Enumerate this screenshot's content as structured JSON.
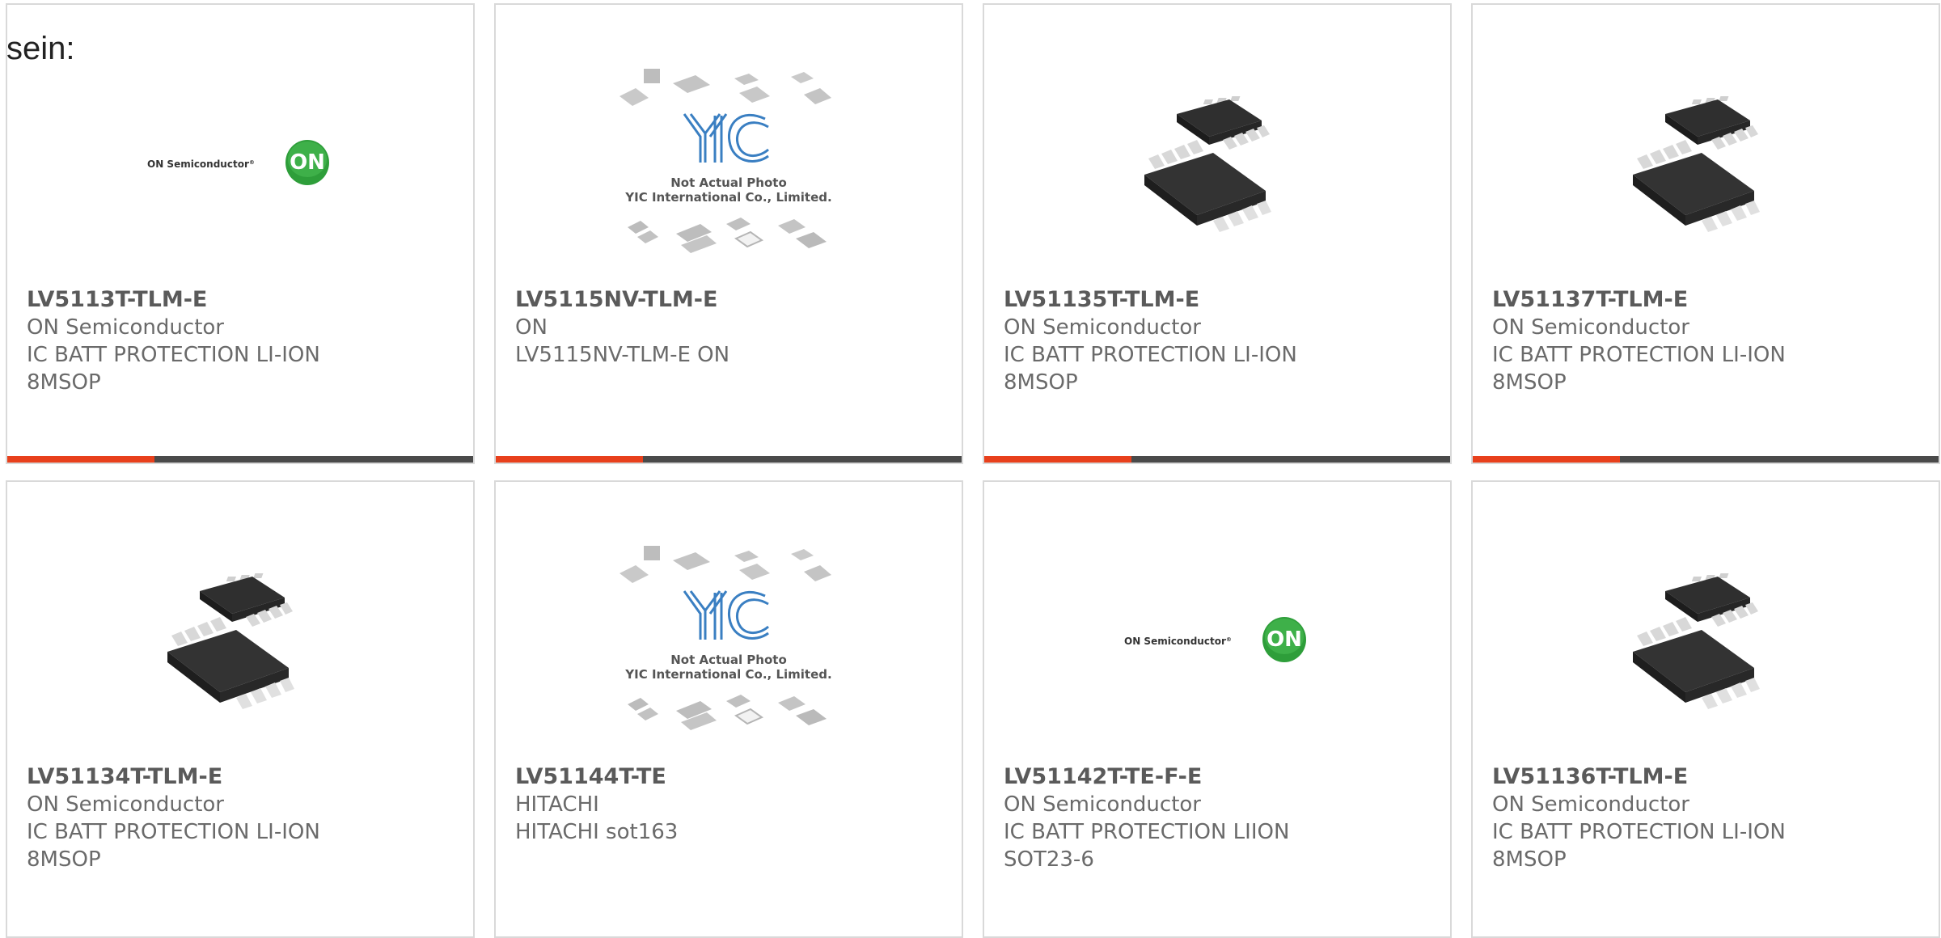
{
  "intro_text": "sein:",
  "colors": {
    "accent": "#e8401c",
    "bar_dark": "#4a4a4a",
    "on_green": "#2e9e3a",
    "yic_blue": "#3a7fc2"
  },
  "products": [
    {
      "part": "LV5113T-TLM-E",
      "manufacturer": "ON Semiconductor",
      "description": "IC BATT PROTECTION LI-ION 8MSOP",
      "image": "on-semiconductor-logo",
      "logo_text": "ON Semiconductor",
      "logo_badge": "ON"
    },
    {
      "part": "LV5115NV-TLM-E",
      "manufacturer": "ON",
      "description": "LV5115NV-TLM-E ON",
      "image": "yic-not-actual-photo",
      "photo_note_1": "Not Actual Photo",
      "photo_note_2": "YIC International Co., Limited."
    },
    {
      "part": "LV51135T-TLM-E",
      "manufacturer": "ON Semiconductor",
      "description": "IC BATT PROTECTION LI-ION 8MSOP",
      "image": "msop-chip-photo"
    },
    {
      "part": "LV51137T-TLM-E",
      "manufacturer": "ON Semiconductor",
      "description": "IC BATT PROTECTION LI-ION 8MSOP",
      "image": "msop-chip-photo"
    },
    {
      "part": "LV51134T-TLM-E",
      "manufacturer": "ON Semiconductor",
      "description": "IC BATT PROTECTION LI-ION 8MSOP",
      "image": "msop-chip-photo"
    },
    {
      "part": "LV51144T-TE",
      "manufacturer": "HITACHI",
      "description": "HITACHI sot163",
      "image": "yic-not-actual-photo",
      "photo_note_1": "Not Actual Photo",
      "photo_note_2": "YIC International Co., Limited."
    },
    {
      "part": "LV51142T-TE-F-E",
      "manufacturer": "ON Semiconductor",
      "description": "IC BATT PROTECTION LIION SOT23-6",
      "image": "on-semiconductor-logo",
      "logo_text": "ON Semiconductor",
      "logo_badge": "ON"
    },
    {
      "part": "LV51136T-TLM-E",
      "manufacturer": "ON Semiconductor",
      "description": "IC BATT PROTECTION LI-ION 8MSOP",
      "image": "msop-chip-photo"
    }
  ]
}
